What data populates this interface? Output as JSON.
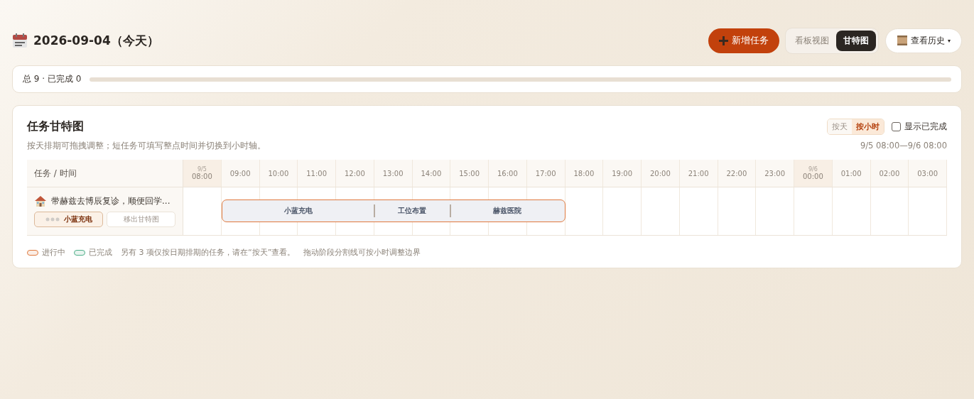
{
  "header": {
    "date": "2026-09-04（今天）",
    "add_button": {
      "label": "新增任务"
    },
    "view_tabs": [
      {
        "label": "看板视图",
        "selected": false
      },
      {
        "label": "甘特图",
        "selected": true
      }
    ],
    "history_button": {
      "label": "查看历史",
      "caret": "▾"
    }
  },
  "progress": {
    "label": "总 9 · 已完成 0",
    "level": 0
  },
  "gantt": {
    "title": "任务甘特图",
    "subtitle": "按天排期可拖拽调整；短任务可填写整点时间并切换到小时轴。",
    "scale_tabs": [
      {
        "label": "按天",
        "selected": false
      },
      {
        "label": "按小时",
        "selected": true
      }
    ],
    "show_done": {
      "label": "显示已完成",
      "checked": false
    },
    "range": "9/5 08:00—9/6 08:00",
    "corner": "任务 / 时间",
    "hours": [
      {
        "date": "9/5",
        "time": "08:00"
      },
      {
        "time": "09:00"
      },
      {
        "time": "10:00"
      },
      {
        "time": "11:00"
      },
      {
        "time": "12:00"
      },
      {
        "time": "13:00"
      },
      {
        "time": "14:00"
      },
      {
        "time": "15:00"
      },
      {
        "time": "16:00"
      },
      {
        "time": "17:00"
      },
      {
        "time": "18:00"
      },
      {
        "time": "19:00"
      },
      {
        "time": "20:00"
      },
      {
        "time": "21:00"
      },
      {
        "time": "22:00"
      },
      {
        "time": "23:00"
      },
      {
        "date": "9/6",
        "time": "00:00"
      },
      {
        "time": "01:00"
      },
      {
        "time": "02:00"
      },
      {
        "time": "03:00"
      }
    ],
    "tasks": [
      {
        "title": "带赫兹去博辰复诊，顺便回学...",
        "status_button": "小蓝充电",
        "remove_button": "移出甘特图",
        "segments": [
          {
            "label": "小蓝充电"
          },
          {
            "label": "工位布置"
          },
          {
            "label": "赫兹医院"
          }
        ],
        "dividers": [
          {
            "level": 0.444
          },
          {
            "level": 0.667
          }
        ]
      }
    ],
    "legend": [
      {
        "label": "进行中",
        "color": "#e07a3f"
      },
      {
        "label": "已完成",
        "color": "#4fb08a"
      }
    ],
    "notes": [
      "另有 3 项仅按日期排期的任务，请在“按天”查看。",
      "拖动阶段分割线可按小时调整边界"
    ]
  }
}
